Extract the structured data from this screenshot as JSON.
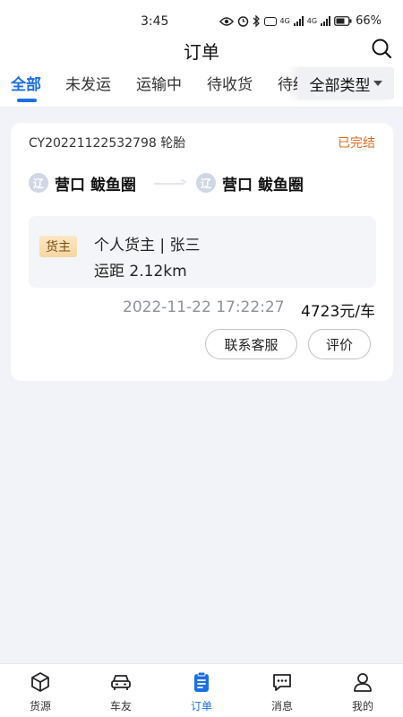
{
  "status_bar": {
    "time": "3:45",
    "net_label_1": "4G",
    "net_label_2": "4G",
    "battery": "66%"
  },
  "header": {
    "title": "订单"
  },
  "tabs": [
    {
      "label": "全部",
      "active": true
    },
    {
      "label": "未发运",
      "active": false
    },
    {
      "label": "运输中",
      "active": false
    },
    {
      "label": "待收货",
      "active": false
    },
    {
      "label": "待结",
      "active": false
    }
  ],
  "type_filter": {
    "label": "全部类型"
  },
  "order": {
    "number": "CY20221122532798 轮胎",
    "status": "已完结",
    "origin": {
      "province_badge": "辽",
      "name": "营口 鲅鱼圈"
    },
    "destination": {
      "province_badge": "辽",
      "name": "营口 鲅鱼圈"
    },
    "owner_badge": "货主",
    "owner": "个人货主 | 张三",
    "distance": "运距 2.12km",
    "datetime": "2022-11-22 17:22:27",
    "price": "4723元/车",
    "actions": {
      "contact": "联系客服",
      "rate": "评价"
    }
  },
  "bottom_nav": [
    {
      "label": "货源",
      "icon": "cube-icon",
      "active": false
    },
    {
      "label": "车友",
      "icon": "car-icon",
      "active": false
    },
    {
      "label": "订单",
      "icon": "clipboard-icon",
      "active": true
    },
    {
      "label": "消息",
      "icon": "message-icon",
      "active": false
    },
    {
      "label": "我的",
      "icon": "user-icon",
      "active": false
    }
  ],
  "colors": {
    "accent": "#1c6fe2",
    "status_done": "#e36a1c",
    "background": "#f1f3f8"
  }
}
